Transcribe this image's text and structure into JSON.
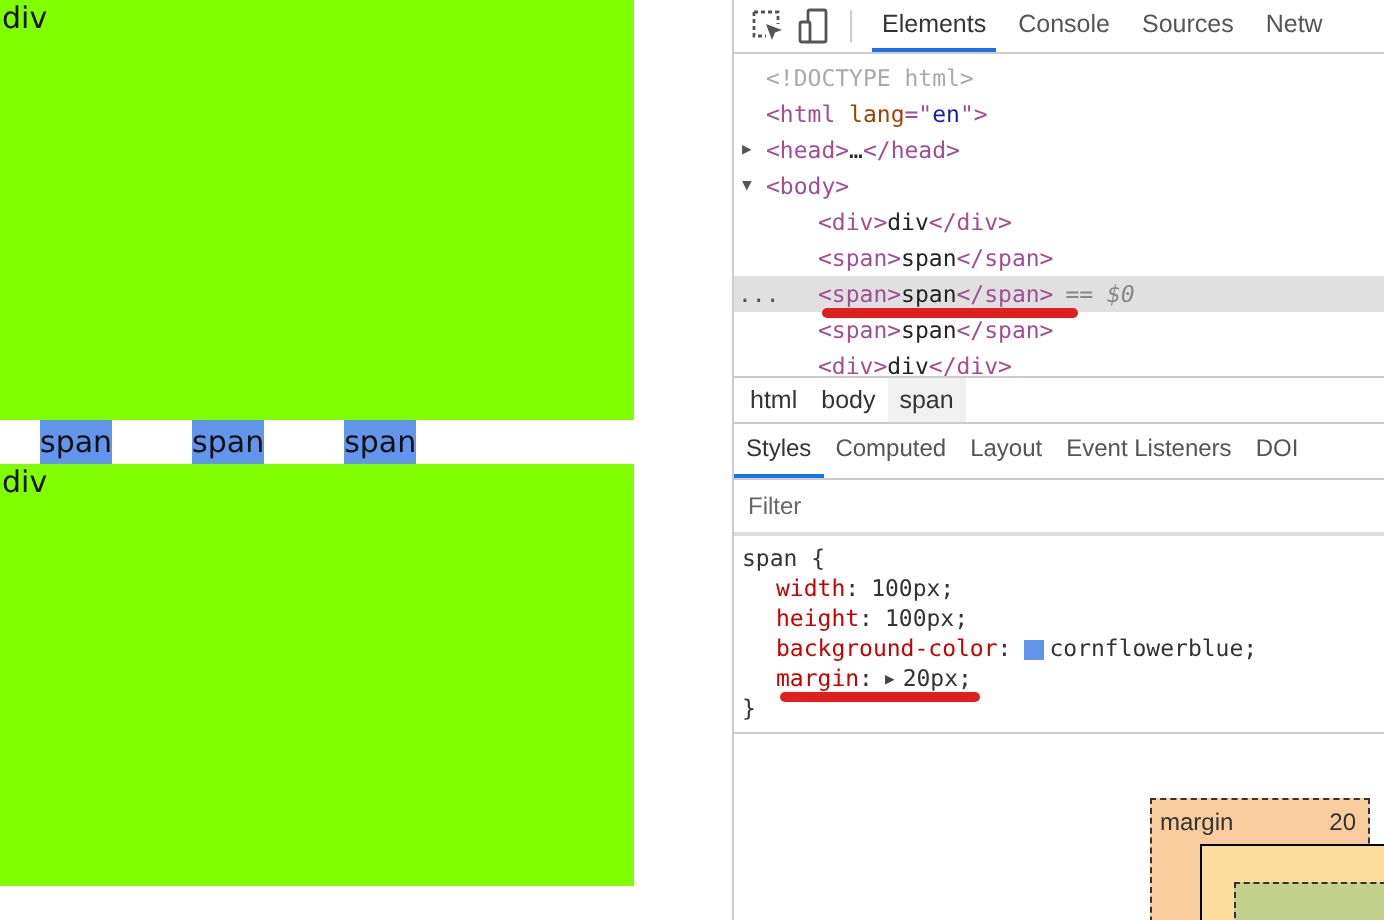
{
  "preview": {
    "blocks": [
      {
        "kind": "div",
        "text": "div"
      },
      {
        "kind": "spans",
        "items": [
          "span",
          "span",
          "span"
        ]
      },
      {
        "kind": "div",
        "text": "div"
      }
    ]
  },
  "devtools": {
    "tabs": [
      {
        "label": "Elements",
        "selected": true
      },
      {
        "label": "Console",
        "selected": false
      },
      {
        "label": "Sources",
        "selected": false
      },
      {
        "label": "Netw",
        "selected": false
      }
    ],
    "dom": [
      {
        "selected": false,
        "tokens": [
          {
            "doctype": "<!DOCTYPE html>"
          }
        ]
      },
      {
        "selected": false,
        "tokens": [
          {
            "tag": "<html "
          },
          {
            "attr": "lang"
          },
          {
            "tag": "=\""
          },
          {
            "value": "en"
          },
          {
            "tag": "\">"
          }
        ],
        "children": [
          {
            "selected": false,
            "arrow": "▶",
            "tokens": [
              {
                "tag": "<head>"
              },
              {
                "text": "…"
              },
              {
                "tag": "</head>"
              }
            ]
          },
          {
            "selected": false,
            "arrow": "▼",
            "tokens": [
              {
                "tag": "<body>"
              }
            ],
            "children": [
              {
                "selected": false,
                "tokens": [
                  {
                    "tag": "<div>"
                  },
                  {
                    "text": "div"
                  },
                  {
                    "tag": "</div>"
                  }
                ]
              },
              {
                "selected": false,
                "tokens": [
                  {
                    "tag": "<span>"
                  },
                  {
                    "text": "span"
                  },
                  {
                    "tag": "</span>"
                  }
                ]
              },
              {
                "selected": true,
                "more": "...",
                "suffix": "== $0",
                "underlined": true,
                "tokens": [
                  {
                    "tag": "<span>"
                  },
                  {
                    "text": "span"
                  },
                  {
                    "tag": "</span>"
                  }
                ]
              },
              {
                "selected": false,
                "tokens": [
                  {
                    "tag": "<span>"
                  },
                  {
                    "text": "span"
                  },
                  {
                    "tag": "</span>"
                  }
                ]
              },
              {
                "selected": false,
                "tokens": [
                  {
                    "tag": "<div>"
                  },
                  {
                    "text": "div"
                  },
                  {
                    "tag": "</div>"
                  }
                ]
              }
            ]
          }
        ]
      }
    ],
    "breadcrumbs": [
      {
        "label": "html",
        "selected": false
      },
      {
        "label": "body",
        "selected": false
      },
      {
        "label": "span",
        "selected": true
      }
    ],
    "subtabs": [
      {
        "label": "Styles",
        "selected": true
      },
      {
        "label": "Computed",
        "selected": false
      },
      {
        "label": "Layout",
        "selected": false
      },
      {
        "label": "Event Listeners",
        "selected": false
      },
      {
        "label": "DOI",
        "selected": false
      }
    ],
    "filter": {
      "placeholder": "Filter"
    },
    "rule": {
      "selector": "span {",
      "close": "}",
      "declarations": [
        {
          "name": "width",
          "sep": ":",
          "value": "100px;"
        },
        {
          "name": "height",
          "sep": ":",
          "value": "100px;"
        },
        {
          "name": "background-color",
          "sep": ":",
          "value": "cornflowerblue;",
          "color": "#6495ed"
        },
        {
          "name": "margin",
          "sep": ":",
          "value": "20px;",
          "expand_arrow": "▶",
          "underlined": true
        }
      ]
    },
    "box_model": {
      "label": "margin",
      "value": "20"
    }
  }
}
